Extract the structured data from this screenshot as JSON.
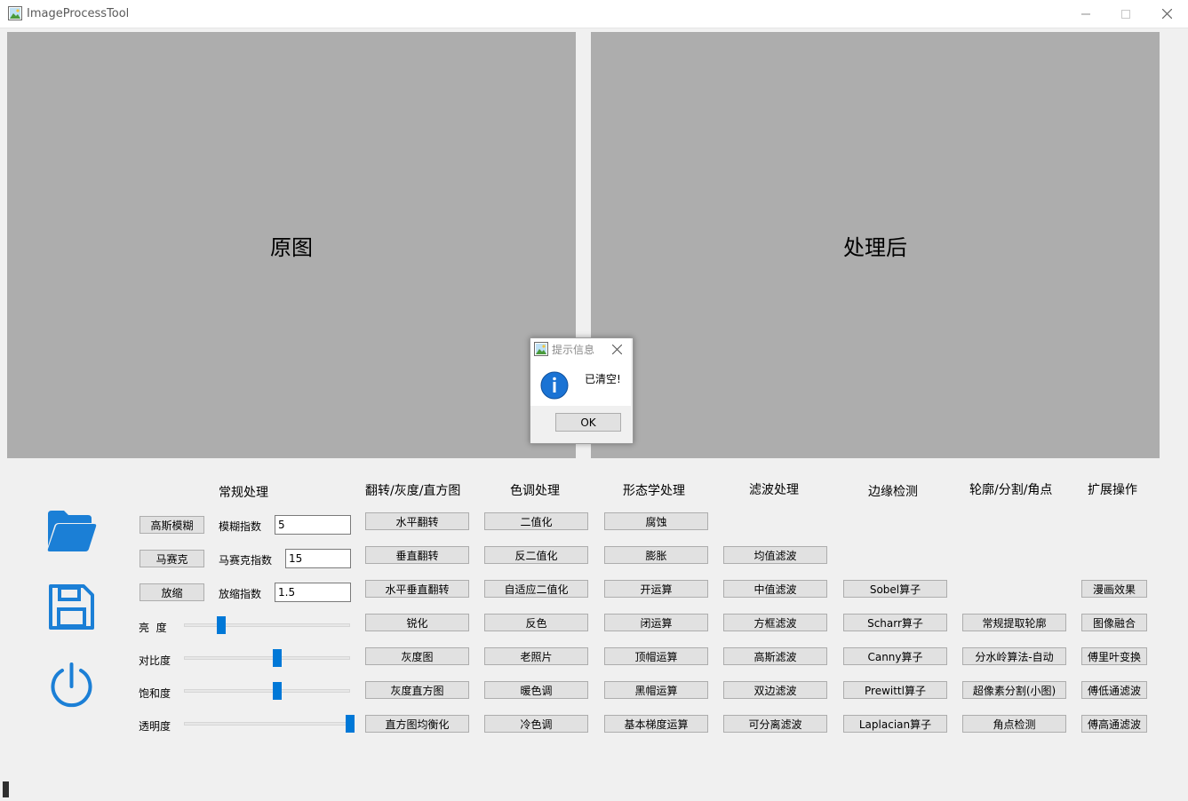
{
  "window": {
    "title": "ImageProcessTool"
  },
  "panels": {
    "original": "原图",
    "processed": "处理后"
  },
  "headers": [
    "常规处理",
    "翻转/灰度/直方图",
    "色调处理",
    "形态学处理",
    "滤波处理",
    "边缘检测",
    "轮廓/分割/角点",
    "扩展操作"
  ],
  "basic": {
    "blur_button": "高斯模糊",
    "blur_label": "模糊指数",
    "blur_value": "5",
    "mosaic_button": "马赛克",
    "mosaic_label": "马赛克指数",
    "mosaic_value": "15",
    "scale_button": "放缩",
    "scale_label": "放缩指数",
    "scale_value": "1.5"
  },
  "sliders": [
    {
      "label": "亮  度",
      "value": 0.12
    },
    {
      "label": "对比度",
      "value": 0.5
    },
    {
      "label": "饱和度",
      "value": 0.5
    },
    {
      "label": "透明度",
      "value": 1.0
    }
  ],
  "columns": {
    "flip": [
      "水平翻转",
      "垂直翻转",
      "水平垂直翻转",
      "锐化",
      "灰度图",
      "灰度直方图",
      "直方图均衡化"
    ],
    "tone": [
      "二值化",
      "反二值化",
      "自适应二值化",
      "反色",
      "老照片",
      "暖色调",
      "冷色调"
    ],
    "morph": [
      "腐蚀",
      "膨胀",
      "开运算",
      "闭运算",
      "顶帽运算",
      "黑帽运算",
      "基本梯度运算"
    ],
    "filter": [
      "均值滤波",
      "中值滤波",
      "方框滤波",
      "高斯滤波",
      "双边滤波",
      "可分离滤波"
    ],
    "edge": [
      "Sobel算子",
      "Scharr算子",
      "Canny算子",
      "Prewittl算子",
      "Laplacian算子"
    ],
    "contour": [
      "常规提取轮廓",
      "分水岭算法-自动",
      "超像素分割(小图)",
      "角点检测"
    ],
    "extend": [
      "漫画效果",
      "图像融合",
      "傅里叶变换",
      "傅低通滤波",
      "傅高通滤波"
    ]
  },
  "dialog": {
    "title": "提示信息",
    "message": "已清空!",
    "ok": "OK"
  },
  "colors": {
    "accent": "#0078d7",
    "panel": "#adadad"
  },
  "icons": [
    "app-icon",
    "folder-open-icon",
    "save-icon",
    "power-icon",
    "info-icon",
    "close-icon"
  ]
}
